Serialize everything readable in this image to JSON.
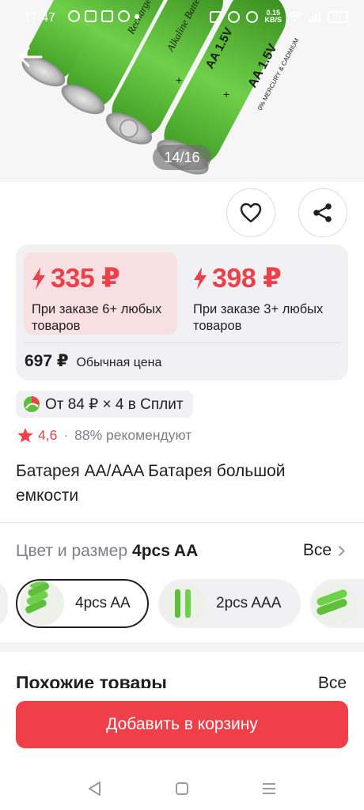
{
  "status_bar": {
    "time": "17:47",
    "net_speed_value": "0.15",
    "net_speed_unit": "KB/S",
    "battery": "57"
  },
  "gallery": {
    "counter": "14/16",
    "battery_labels": [
      "AA 1.5V",
      "AA 1.5V",
      "Rechargeable",
      "Alkaline Battery",
      "0% MERCURY & CADMIUM"
    ]
  },
  "prices": {
    "tiers": [
      {
        "amount": "335 ₽",
        "condition": "При заказе 6+ любых товаров",
        "selected": true
      },
      {
        "amount": "398 ₽",
        "condition": "При заказе 3+ любых товаров",
        "selected": false
      }
    ],
    "regular_amount": "697 ₽",
    "regular_label": "Обычная цена"
  },
  "split": {
    "text": "От 84 ₽ × 4 в Сплит"
  },
  "rating": {
    "value": "4,6",
    "separator": "·",
    "recommend": "88% рекомендуют"
  },
  "product": {
    "title": "Батарея AA/AAA Батарея большой емкости"
  },
  "variants": {
    "label": "Цвет и размер",
    "selected": "4pcs AA",
    "see_all": "Все",
    "items": [
      {
        "label": "4pcs AA",
        "selected": true
      },
      {
        "label": "2pcs AAA",
        "selected": false
      },
      {
        "label": "",
        "selected": false
      }
    ]
  },
  "similar": {
    "title": "Похожие товары",
    "see_all": "Все"
  },
  "actions": {
    "add_to_cart": "Добавить в корзину"
  },
  "colors": {
    "accent": "#ef3f49",
    "price_tile_selected": "#f8dfe1",
    "card_bg": "#f1f1f4",
    "battery_green": "#5fbf3c",
    "text": "#1f1f1f",
    "muted": "#7d7d85"
  },
  "icons": {
    "back": "arrow-left-icon",
    "favorite": "heart-icon",
    "share": "share-icon",
    "price": "lightning-icon",
    "split": "split-logo-icon",
    "rating": "star-icon",
    "chevron": "chevron-right-icon"
  }
}
